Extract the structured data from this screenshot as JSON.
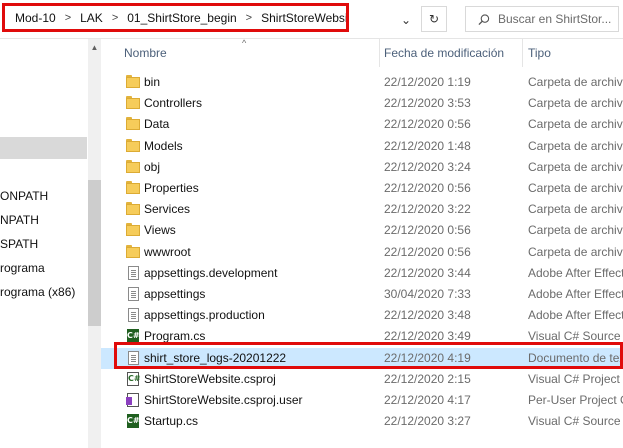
{
  "addressbar": {
    "breadcrumbs": [
      "Mod-10",
      "LAK",
      "01_ShirtStore_begin",
      "ShirtStoreWebsite"
    ],
    "separator": ">",
    "dropdown_glyph": "⌄",
    "refresh_glyph": "↻",
    "search_placeholder": "Buscar en ShirtStor..."
  },
  "navpane": {
    "items": [
      "ONPATH",
      "NPATH",
      "SPATH",
      "rograma",
      "rograma (x86)"
    ]
  },
  "columns": {
    "name": "Nombre",
    "date": "Fecha de modificación",
    "type": "Tipo",
    "sort_glyph": "^"
  },
  "files": [
    {
      "name": "bin",
      "date": "22/12/2020 1:19",
      "type": "Carpeta de archivos",
      "icon": "folder-icon"
    },
    {
      "name": "Controllers",
      "date": "22/12/2020 3:53",
      "type": "Carpeta de archivos",
      "icon": "folder-icon"
    },
    {
      "name": "Data",
      "date": "22/12/2020 0:56",
      "type": "Carpeta de archivos",
      "icon": "folder-icon"
    },
    {
      "name": "Models",
      "date": "22/12/2020 1:48",
      "type": "Carpeta de archivos",
      "icon": "folder-icon"
    },
    {
      "name": "obj",
      "date": "22/12/2020 3:24",
      "type": "Carpeta de archivos",
      "icon": "folder-icon"
    },
    {
      "name": "Properties",
      "date": "22/12/2020 0:56",
      "type": "Carpeta de archivos",
      "icon": "folder-icon"
    },
    {
      "name": "Services",
      "date": "22/12/2020 3:22",
      "type": "Carpeta de archivos",
      "icon": "folder-icon"
    },
    {
      "name": "Views",
      "date": "22/12/2020 0:56",
      "type": "Carpeta de archivos",
      "icon": "folder-icon"
    },
    {
      "name": "wwwroot",
      "date": "22/12/2020 0:56",
      "type": "Carpeta de archivos",
      "icon": "folder-icon"
    },
    {
      "name": "appsettings.development",
      "date": "22/12/2020 3:44",
      "type": "Adobe After Effects",
      "icon": "json-file-icon"
    },
    {
      "name": "appsettings",
      "date": "30/04/2020 7:33",
      "type": "Adobe After Effects",
      "icon": "json-file-icon"
    },
    {
      "name": "appsettings.production",
      "date": "22/12/2020 3:48",
      "type": "Adobe After Effects",
      "icon": "json-file-icon"
    },
    {
      "name": "Program.cs",
      "date": "22/12/2020 3:49",
      "type": "Visual C# Source File",
      "icon": "csharp-file-icon"
    },
    {
      "name": "shirt_store_logs-20201222",
      "date": "22/12/2020 4:19",
      "type": "Documento de texto",
      "icon": "text-file-icon",
      "selected": true
    },
    {
      "name": "ShirtStoreWebsite.csproj",
      "date": "22/12/2020 2:15",
      "type": "Visual C# Project file",
      "icon": "csproj-file-icon"
    },
    {
      "name": "ShirtStoreWebsite.csproj.user",
      "date": "22/12/2020 4:17",
      "type": "Per-User Project Options",
      "icon": "user-file-icon"
    },
    {
      "name": "Startup.cs",
      "date": "22/12/2020 3:27",
      "type": "Visual C# Source File",
      "icon": "csharp-file-icon"
    }
  ],
  "colors": {
    "highlight_outline": "#e00b0b",
    "selected_row": "#cce8ff",
    "folder": "#f6cc5a",
    "column_header_text": "#4c607a"
  }
}
